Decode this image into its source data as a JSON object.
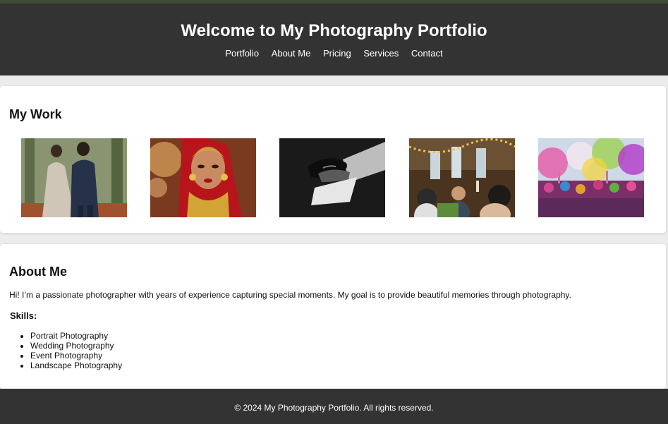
{
  "header": {
    "title": "Welcome to My Photography Portfolio",
    "nav": [
      "Portfolio",
      "About Me",
      "Pricing",
      "Services",
      "Contact"
    ]
  },
  "work": {
    "heading": "My Work",
    "images": [
      "wedding-couple-photo",
      "bride-portrait-photo",
      "hands-shadow-photo",
      "event-celebration-photo",
      "color-festival-photo"
    ]
  },
  "about": {
    "heading": "About Me",
    "text": "Hi! I’m a passionate photographer with years of experience capturing special moments. My goal is to provide beautiful memories through photography.",
    "skills_title": "Skills:",
    "skills": [
      "Portrait Photography",
      "Wedding Photography",
      "Event Photography",
      "Landscape Photography"
    ]
  },
  "footer": {
    "text": "© 2024 My Photography Portfolio. All rights reserved."
  },
  "colors": {
    "header_bg": "#333333",
    "page_bg": "#ececec"
  }
}
